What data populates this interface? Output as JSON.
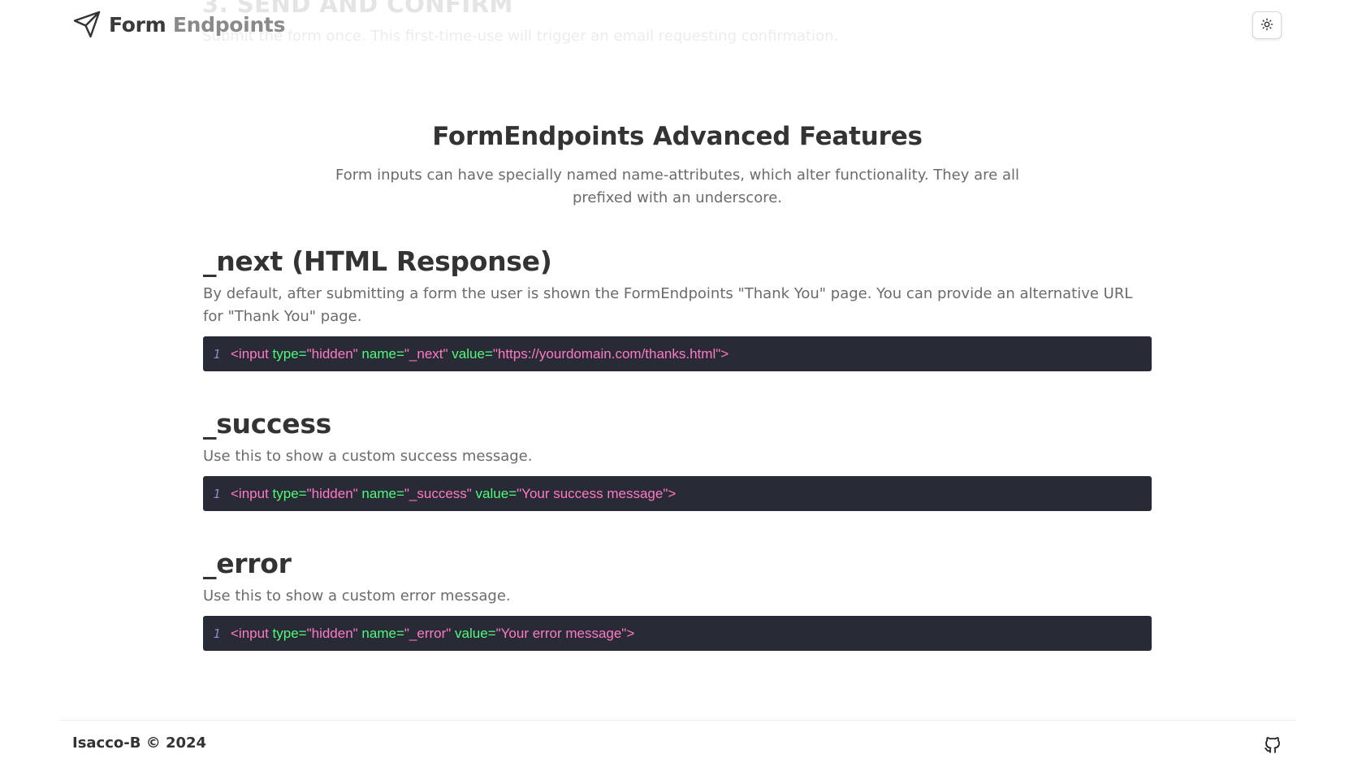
{
  "ghost": {
    "title": "3. SEND AND CONFIRM",
    "text": "Submit the form once. This first-time-use will trigger an email requesting confirmation."
  },
  "header": {
    "brand_part1": "Form",
    "brand_part2": "Endpoints",
    "logo_icon": "paper-plane-icon",
    "theme_icon": "sun-icon"
  },
  "main": {
    "title": "FormEndpoints Advanced Features",
    "lead": "Form inputs can have specially named name-attributes, which alter functionality. They are all prefixed with an underscore.",
    "features": [
      {
        "heading": "_next (HTML Response)",
        "description": "By default, after submitting a form the user is shown the FormEndpoints \"Thank You\" page. You can provide an alternative URL for \"Thank You\" page.",
        "line": "1",
        "code": {
          "open": "<input ",
          "attr1": "type=",
          "val1": "\"hidden\"",
          "attr2": " name=",
          "val2": "\"_next\"",
          "attr3": " value=",
          "val3": "\"https://yourdomain.com/thanks.html\"",
          "close": ">"
        }
      },
      {
        "heading": "_success",
        "description": "Use this to show a custom success message.",
        "line": "1",
        "code": {
          "open": "<input ",
          "attr1": "type=",
          "val1": "\"hidden\"",
          "attr2": " name=",
          "val2": "\"_success\"",
          "attr3": " value=",
          "val3": "\"Your success message\"",
          "close": ">"
        }
      },
      {
        "heading": "_error",
        "description": "Use this to show a custom error message.",
        "line": "1",
        "code": {
          "open": "<input ",
          "attr1": "type=",
          "val1": "\"hidden\"",
          "attr2": " name=",
          "val2": "\"_error\"",
          "attr3": " value=",
          "val3": "\"Your error message\"",
          "close": ">"
        }
      }
    ]
  },
  "footer": {
    "copyright": "Isacco-B © 2024",
    "github_icon": "github-icon"
  },
  "colors": {
    "code_bg": "#282a36",
    "code_tag": "#ff79c6",
    "code_attr": "#50fa7b",
    "line_number": "#8b8fc7"
  }
}
